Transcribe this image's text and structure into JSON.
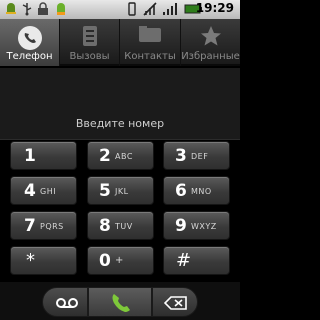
{
  "status_bar": {
    "time": "19:29",
    "icons": [
      "android-icon",
      "usb-icon",
      "lock-icon",
      "android-icon",
      "vibrate-icon",
      "no-signal-icon",
      "signal-icon",
      "battery-icon"
    ]
  },
  "tabs": [
    {
      "label": "Телефон",
      "icon": "phone-icon",
      "active": true
    },
    {
      "label": "Вызовы",
      "icon": "call-log-icon",
      "active": false
    },
    {
      "label": "Контакты",
      "icon": "contacts-icon",
      "active": false
    },
    {
      "label": "Избранные",
      "icon": "star-icon",
      "active": false
    }
  ],
  "number_input": {
    "value": "",
    "placeholder": "Введите номер"
  },
  "keypad": {
    "keys": [
      {
        "digit": "1",
        "letters": ""
      },
      {
        "digit": "2",
        "letters": "ABC"
      },
      {
        "digit": "3",
        "letters": "DEF"
      },
      {
        "digit": "4",
        "letters": "GHI"
      },
      {
        "digit": "5",
        "letters": "JKL"
      },
      {
        "digit": "6",
        "letters": "MNO"
      },
      {
        "digit": "7",
        "letters": "PQRS"
      },
      {
        "digit": "8",
        "letters": "TUV"
      },
      {
        "digit": "9",
        "letters": "WXYZ"
      },
      {
        "digit": "*",
        "letters": ""
      },
      {
        "digit": "0",
        "letters": "+"
      },
      {
        "digit": "#",
        "letters": ""
      }
    ]
  },
  "bottom_bar": {
    "voicemail_icon": "voicemail-icon",
    "call_icon": "call-icon",
    "delete_icon": "backspace-icon",
    "accent_color": "#7ec83a"
  }
}
